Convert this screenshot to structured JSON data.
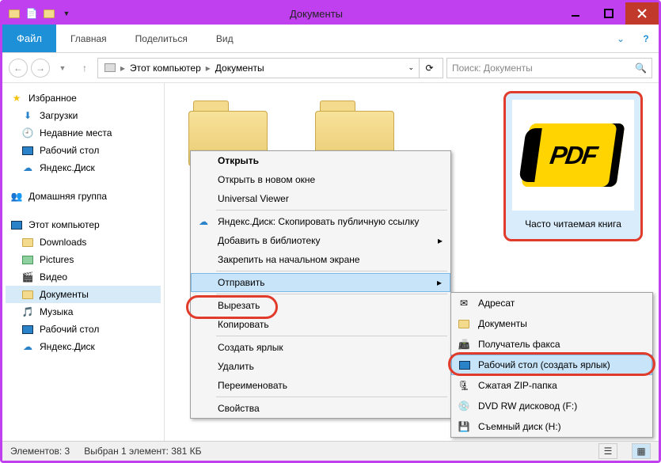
{
  "window": {
    "title": "Документы"
  },
  "ribbon": {
    "file": "Файл",
    "tabs": [
      "Главная",
      "Поделиться",
      "Вид"
    ]
  },
  "nav": {
    "computer": "Этот компьютер",
    "folder": "Документы",
    "search_placeholder": "Поиск: Документы"
  },
  "sidebar": {
    "favorites": {
      "label": "Избранное",
      "items": [
        "Загрузки",
        "Недавние места",
        "Рабочий стол",
        "Яндекс.Диск"
      ]
    },
    "homegroup": "Домашняя группа",
    "computer": {
      "label": "Этот компьютер",
      "items": [
        "Downloads",
        "Pictures",
        "Видео",
        "Документы",
        "Музыка",
        "Рабочий стол",
        "Яндекс.Диск"
      ]
    },
    "selected": "Документы"
  },
  "pdf_tile": {
    "label": "Часто читаемая книга",
    "logo_text": "PDF"
  },
  "ctx": {
    "open": "Открыть",
    "open_new": "Открыть в новом окне",
    "universal": "Universal Viewer",
    "yandex": "Яндекс.Диск: Скопировать публичную ссылку",
    "library": "Добавить в библиотеку",
    "pin": "Закрепить на начальном экране",
    "send": "Отправить",
    "cut": "Вырезать",
    "copy": "Копировать",
    "shortcut": "Создать ярлык",
    "delete": "Удалить",
    "rename": "Переименовать",
    "props": "Свойства"
  },
  "sendto": {
    "addr": "Адресат",
    "docs": "Документы",
    "fax": "Получатель факса",
    "desktop": "Рабочий стол (создать ярлык)",
    "zip": "Сжатая ZIP-папка",
    "dvd": "DVD RW дисковод (F:)",
    "usb": "Съемный диск (H:)"
  },
  "status": {
    "count": "Элементов: 3",
    "selected": "Выбран 1 элемент: 381 КБ"
  }
}
